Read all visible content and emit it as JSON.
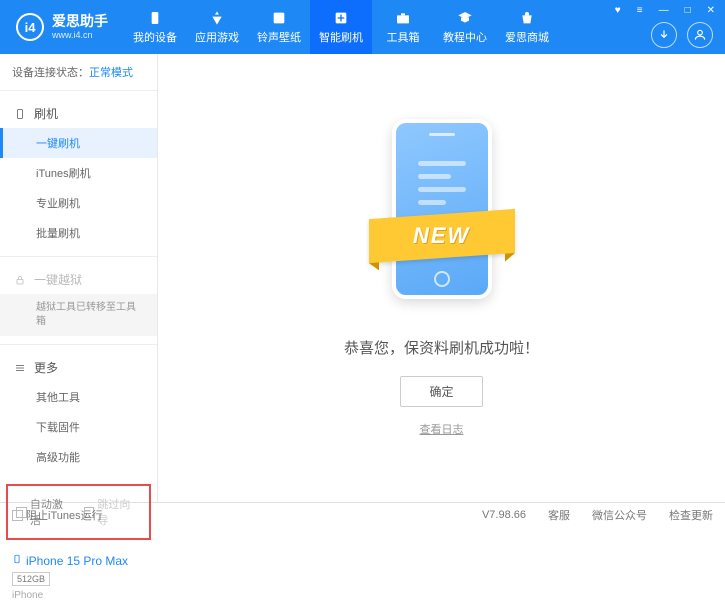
{
  "header": {
    "logo_title": "爱思助手",
    "logo_url": "www.i4.cn",
    "nav": [
      {
        "label": "我的设备"
      },
      {
        "label": "应用游戏"
      },
      {
        "label": "铃声壁纸"
      },
      {
        "label": "智能刷机"
      },
      {
        "label": "工具箱"
      },
      {
        "label": "教程中心"
      },
      {
        "label": "爱思商城"
      }
    ]
  },
  "sidebar": {
    "status_label": "设备连接状态：",
    "status_value": "正常模式",
    "section_flash": "刷机",
    "items_flash": [
      "一键刷机",
      "iTunes刷机",
      "专业刷机",
      "批量刷机"
    ],
    "section_jailbreak": "一键越狱",
    "jailbreak_note": "越狱工具已转移至工具箱",
    "section_more": "更多",
    "items_more": [
      "其他工具",
      "下载固件",
      "高级功能"
    ],
    "chk_auto_activate": "自动激活",
    "chk_skip_guide": "跳过向导",
    "device_name": "iPhone 15 Pro Max",
    "device_storage": "512GB",
    "device_type": "iPhone"
  },
  "main": {
    "ribbon": "NEW",
    "success_text": "恭喜您，保资料刷机成功啦！",
    "ok_button": "确定",
    "log_link": "查看日志"
  },
  "footer": {
    "block_itunes": "阻止iTunes运行",
    "version": "V7.98.66",
    "service": "客服",
    "wechat": "微信公众号",
    "check_update": "检查更新"
  }
}
